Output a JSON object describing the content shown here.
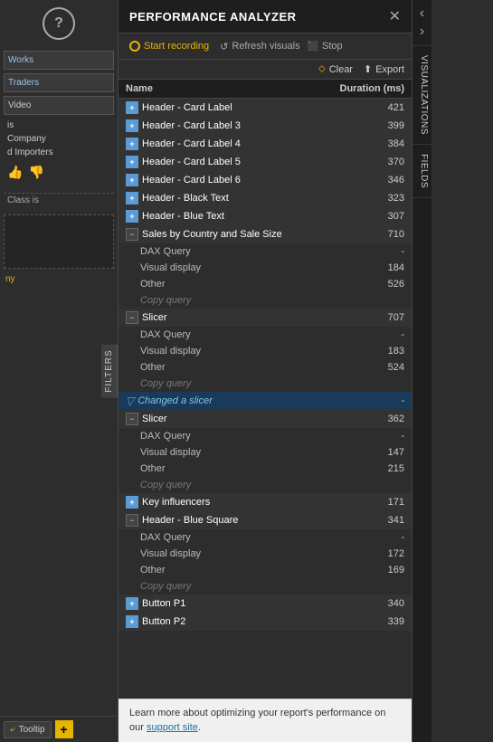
{
  "app": {
    "title": "PERFORMANCE ANALYZER"
  },
  "toolbar": {
    "start_recording_label": "Start recording",
    "refresh_visuals_label": "Refresh visuals",
    "stop_label": "Stop",
    "clear_label": "Clear",
    "export_label": "Export"
  },
  "table": {
    "col_name": "Name",
    "col_duration": "Duration (ms)"
  },
  "rows": [
    {
      "id": "r1",
      "level": "top",
      "name": "Header - Card Label",
      "duration": "421",
      "expanded": false
    },
    {
      "id": "r2",
      "level": "top",
      "name": "Header - Card Label 3",
      "duration": "399",
      "expanded": false
    },
    {
      "id": "r3",
      "level": "top",
      "name": "Header - Card Label 4",
      "duration": "384",
      "expanded": false
    },
    {
      "id": "r4",
      "level": "top",
      "name": "Header - Card Label 5",
      "duration": "370",
      "expanded": false
    },
    {
      "id": "r5",
      "level": "top",
      "name": "Header - Card Label 6",
      "duration": "346",
      "expanded": false
    },
    {
      "id": "r6",
      "level": "top",
      "name": "Header - Black Text",
      "duration": "323",
      "expanded": false
    },
    {
      "id": "r7",
      "level": "top",
      "name": "Header - Blue Text",
      "duration": "307",
      "expanded": false
    },
    {
      "id": "r8",
      "level": "top-expanded",
      "name": "Sales by Country and Sale Size",
      "duration": "710",
      "expanded": true
    },
    {
      "id": "r8a",
      "level": "sub",
      "name": "DAX Query",
      "duration": "-"
    },
    {
      "id": "r8b",
      "level": "sub",
      "name": "Visual display",
      "duration": "184"
    },
    {
      "id": "r8c",
      "level": "sub",
      "name": "Other",
      "duration": "526"
    },
    {
      "id": "r8d",
      "level": "copy",
      "name": "Copy query",
      "duration": ""
    },
    {
      "id": "r9",
      "level": "top-expanded",
      "name": "Slicer",
      "duration": "707",
      "expanded": true
    },
    {
      "id": "r9a",
      "level": "sub",
      "name": "DAX Query",
      "duration": "-"
    },
    {
      "id": "r9b",
      "level": "sub",
      "name": "Visual display",
      "duration": "183"
    },
    {
      "id": "r9c",
      "level": "sub",
      "name": "Other",
      "duration": "524"
    },
    {
      "id": "r9d",
      "level": "copy",
      "name": "Copy query",
      "duration": ""
    },
    {
      "id": "r10",
      "level": "changed-slicer",
      "name": "Changed a slicer",
      "duration": "-"
    },
    {
      "id": "r11",
      "level": "top-expanded",
      "name": "Slicer",
      "duration": "362",
      "expanded": true
    },
    {
      "id": "r11a",
      "level": "sub",
      "name": "DAX Query",
      "duration": "-"
    },
    {
      "id": "r11b",
      "level": "sub",
      "name": "Visual display",
      "duration": "147"
    },
    {
      "id": "r11c",
      "level": "sub",
      "name": "Other",
      "duration": "215"
    },
    {
      "id": "r11d",
      "level": "copy",
      "name": "Copy query",
      "duration": ""
    },
    {
      "id": "r12",
      "level": "top",
      "name": "Key influencers",
      "duration": "171",
      "expanded": false
    },
    {
      "id": "r13",
      "level": "top-expanded",
      "name": "Header - Blue Square",
      "duration": "341",
      "expanded": true
    },
    {
      "id": "r13a",
      "level": "sub",
      "name": "DAX Query",
      "duration": "-"
    },
    {
      "id": "r13b",
      "level": "sub",
      "name": "Visual display",
      "duration": "172"
    },
    {
      "id": "r13c",
      "level": "sub",
      "name": "Other",
      "duration": "169"
    },
    {
      "id": "r13d",
      "level": "copy",
      "name": "Copy query",
      "duration": ""
    },
    {
      "id": "r14",
      "level": "top",
      "name": "Button P1",
      "duration": "340",
      "expanded": false
    },
    {
      "id": "r15",
      "level": "top",
      "name": "Button P2",
      "duration": "339",
      "expanded": false
    }
  ],
  "footer": {
    "text": "Learn more about optimizing your report's performance on our ",
    "link_text": "support site",
    "link_suffix": "."
  },
  "left_panel": {
    "filters_label": "FILTERS",
    "canvas_items": [
      "Works",
      "Traders",
      "Video",
      "is",
      "Company",
      "d Importers"
    ],
    "class_label": "Class is"
  },
  "right_sidebar": {
    "tabs": [
      "VISUALIZATIONS",
      "FIELDS"
    ]
  },
  "bottom_bar": {
    "tooltip_label": "Tooltip",
    "add_label": "+"
  },
  "nav": {
    "back": "‹",
    "forward": "›"
  }
}
